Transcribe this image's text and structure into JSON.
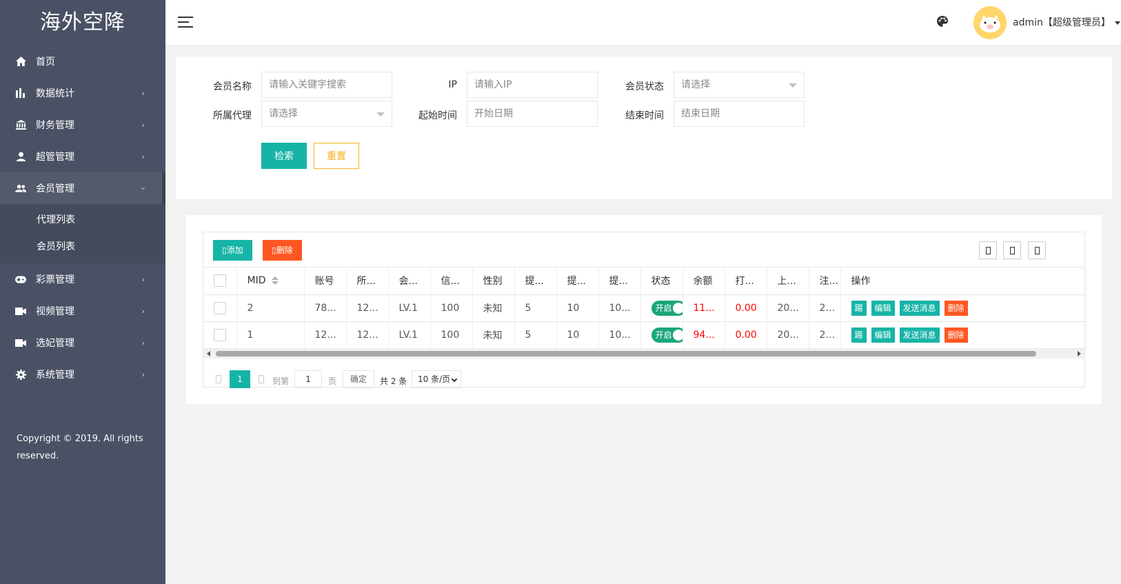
{
  "app": {
    "title": "海外空降"
  },
  "sidebar": {
    "items": [
      {
        "label": "首页",
        "icon": "home-icon",
        "arrow": ""
      },
      {
        "label": "数据统计",
        "icon": "bar-chart-icon",
        "arrow": "›"
      },
      {
        "label": "财务管理",
        "icon": "bank-icon",
        "arrow": "›"
      },
      {
        "label": "超管管理",
        "icon": "user-icon",
        "arrow": "›"
      },
      {
        "label": "会员管理",
        "icon": "users-icon",
        "arrow": "›"
      },
      {
        "label": "彩票管理",
        "icon": "gamepad-icon",
        "arrow": "›"
      },
      {
        "label": "视频管理",
        "icon": "video-icon",
        "arrow": "›"
      },
      {
        "label": "选妃管理",
        "icon": "video-icon",
        "arrow": "›"
      },
      {
        "label": "系统管理",
        "icon": "gear-icon",
        "arrow": "›"
      }
    ],
    "sub_items": [
      "代理列表",
      "会员列表"
    ],
    "copyright": "Copyright © 2019. All rights reserved."
  },
  "header": {
    "user": "admin【超级管理员】",
    "icons": [
      "menu-icon",
      "palette-icon",
      "avatar",
      "caret-down-icon"
    ]
  },
  "search": {
    "member_name_label": "会员名称",
    "member_name_placeholder": "请输入关键字搜索",
    "ip_label": "IP",
    "ip_placeholder": "请输入IP",
    "status_label": "会员状态",
    "status_placeholder": "请选择",
    "agent_label": "所属代理",
    "agent_placeholder": "请选择",
    "start_label": "起始时间",
    "start_placeholder": "开始日期",
    "end_label": "结束时间",
    "end_placeholder": "结束日期",
    "search_button": "检索",
    "reset_button": "重置"
  },
  "toolbar": {
    "add_label": "添加",
    "delete_label": "删除"
  },
  "table": {
    "headers": [
      "MID",
      "账号",
      "所...",
      "会...",
      "信...",
      "性别",
      "提...",
      "提...",
      "提...",
      "状态",
      "余额",
      "打...",
      "上...",
      "注...",
      "操作"
    ],
    "rows": [
      {
        "mid": "2",
        "account": "78...",
        "agent": "12...",
        "level": "LV.1",
        "credit": "100",
        "gender": "未知",
        "w1": "5",
        "w2": "10",
        "w3": "10...",
        "status": "开启",
        "balance": "11...",
        "bet": "0.00",
        "last": "20...",
        "reg": "20..."
      },
      {
        "mid": "1",
        "account": "12...",
        "agent": "12...",
        "level": "LV.1",
        "credit": "100",
        "gender": "未知",
        "w1": "5",
        "w2": "10",
        "w3": "10...",
        "status": "开启",
        "balance": "94...",
        "bet": "0.00",
        "last": "20...",
        "reg": "20..."
      }
    ],
    "ops": {
      "a": "踢",
      "b": "编辑",
      "c": "发送消息",
      "d": "删除"
    }
  },
  "pager": {
    "current": "1",
    "goto_label": "到第",
    "goto_value": "1",
    "page_label": "页",
    "ok_label": "确定",
    "total": "共 2 条",
    "page_size": "10 条/页"
  },
  "colors": {
    "accent": "#16b4a6",
    "danger": "#ff5722",
    "sidebar": "#4a5164",
    "reset": "#f3b21b",
    "switch": "#1aa67b"
  }
}
